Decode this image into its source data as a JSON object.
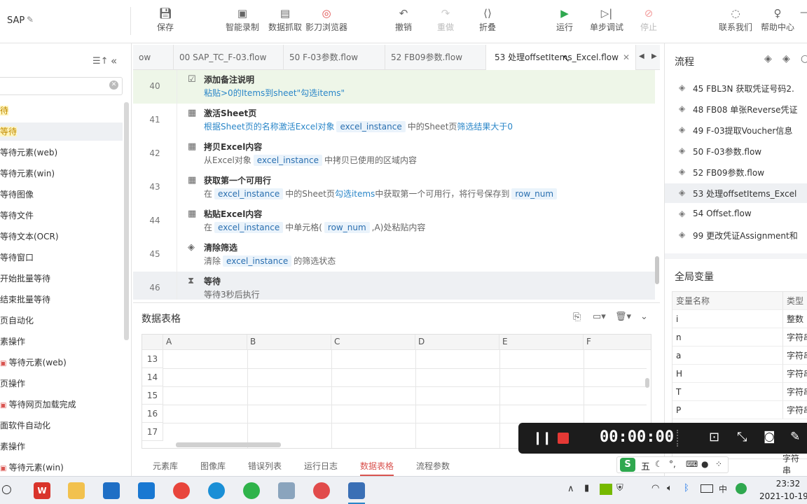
{
  "app": {
    "title": "SAP",
    "edit_icon": "pencil-icon"
  },
  "toolbar": {
    "save": "保存",
    "smart_record": "智能录制",
    "data_capture": "数据抓取",
    "browser": "影刀浏览器",
    "undo": "撤销",
    "redo": "重做",
    "fold": "折叠",
    "run": "运行",
    "step_debug": "单步调试",
    "stop": "停止",
    "contact": "联系我们",
    "help": "帮助中心"
  },
  "left_panel": {
    "items": [
      "待",
      "等待",
      "等待元素(web)",
      "等待元素(win)",
      "等待图像",
      "等待文件",
      "等待文本(OCR)",
      "等待窗口",
      "开始批量等待",
      "结束批量等待",
      "页自动化",
      "素操作",
      "等待元素(web)",
      "页操作",
      "等待网页加载完成",
      "面软件自动化",
      "素操作",
      "等待元素(win)"
    ]
  },
  "tabs": [
    "ow",
    "00 SAP_TC_F-03.flow",
    "50 F-03参数.flow",
    "52 FB09参数.flow",
    "53 处理offsetItems_Excel.flow"
  ],
  "flow_steps": [
    {
      "line": "40",
      "title": "添加备注说明",
      "desc": "粘贴>0的Items到sheet\"勾选items\""
    },
    {
      "line": "41",
      "title": "激活Sheet页",
      "desc_a": "根据Sheet页的名称激活Excel对象",
      "var1": "excel_instance",
      "desc_b": "中的Sheet页",
      "desc_c": "筛选结果大于0"
    },
    {
      "line": "42",
      "title": "拷贝Excel内容",
      "desc_a": "从Excel对象",
      "var1": "excel_instance",
      "desc_b": "中拷贝已使用的区域内容"
    },
    {
      "line": "43",
      "title": "获取第一个可用行",
      "desc_a": "在",
      "var1": "excel_instance",
      "desc_b": "中的Sheet页",
      "desc_c": "勾选items",
      "desc_d": "中获取第一个可用行，将行号保存到",
      "var2": "row_num"
    },
    {
      "line": "44",
      "title": "粘贴Excel内容",
      "desc_a": "在",
      "var1": "excel_instance",
      "desc_b": "中单元格(",
      "var2": "row_num",
      "desc_c": ",A)处粘贴内容"
    },
    {
      "line": "45",
      "title": "清除筛选",
      "desc_a": "清除",
      "var1": "excel_instance",
      "desc_b": "的筛选状态"
    },
    {
      "line": "46",
      "title": "等待",
      "desc": "等待3秒后执行"
    }
  ],
  "data_table": {
    "title": "数据表格",
    "columns": [
      "A",
      "B",
      "C",
      "D",
      "E",
      "F"
    ],
    "rows": [
      "13",
      "14",
      "15",
      "16",
      "17"
    ]
  },
  "bottom_tabs": [
    "元素库",
    "图像库",
    "错误列表",
    "运行日志",
    "数据表格",
    "流程参数"
  ],
  "right_panel": {
    "flow_title": "流程",
    "flows": [
      "45 FBL3N 获取凭证号码2.",
      "48 FB08 单张Reverse凭证",
      "49 F-03提取Voucher信息",
      "50 F-03参数.flow",
      "52 FB09参数.flow",
      "53 处理offsetItems_Excel",
      "54 Offset.flow",
      "99 更改凭证Assignment和"
    ],
    "globals_title": "全局变量",
    "var_header": [
      "变量名称",
      "类型"
    ],
    "vars": [
      {
        "name": "i",
        "type": "整数"
      },
      {
        "name": "n",
        "type": "字符串"
      },
      {
        "name": "a",
        "type": "字符串"
      },
      {
        "name": "H",
        "type": "字符串"
      },
      {
        "name": "T",
        "type": "字符串"
      },
      {
        "name": "P",
        "type": "字符串"
      },
      {
        "name": "",
        "type": "字符串"
      }
    ]
  },
  "recorder": {
    "time": "00:00:00"
  },
  "ime": {
    "label": "五"
  },
  "taskbar": {
    "time": "23:32",
    "date": "2021-10-19"
  },
  "colors": {
    "accent": "#2a86c8",
    "run_green": "#2fa84f",
    "stop_red": "#e05050",
    "highlight": "#fff5c0"
  }
}
